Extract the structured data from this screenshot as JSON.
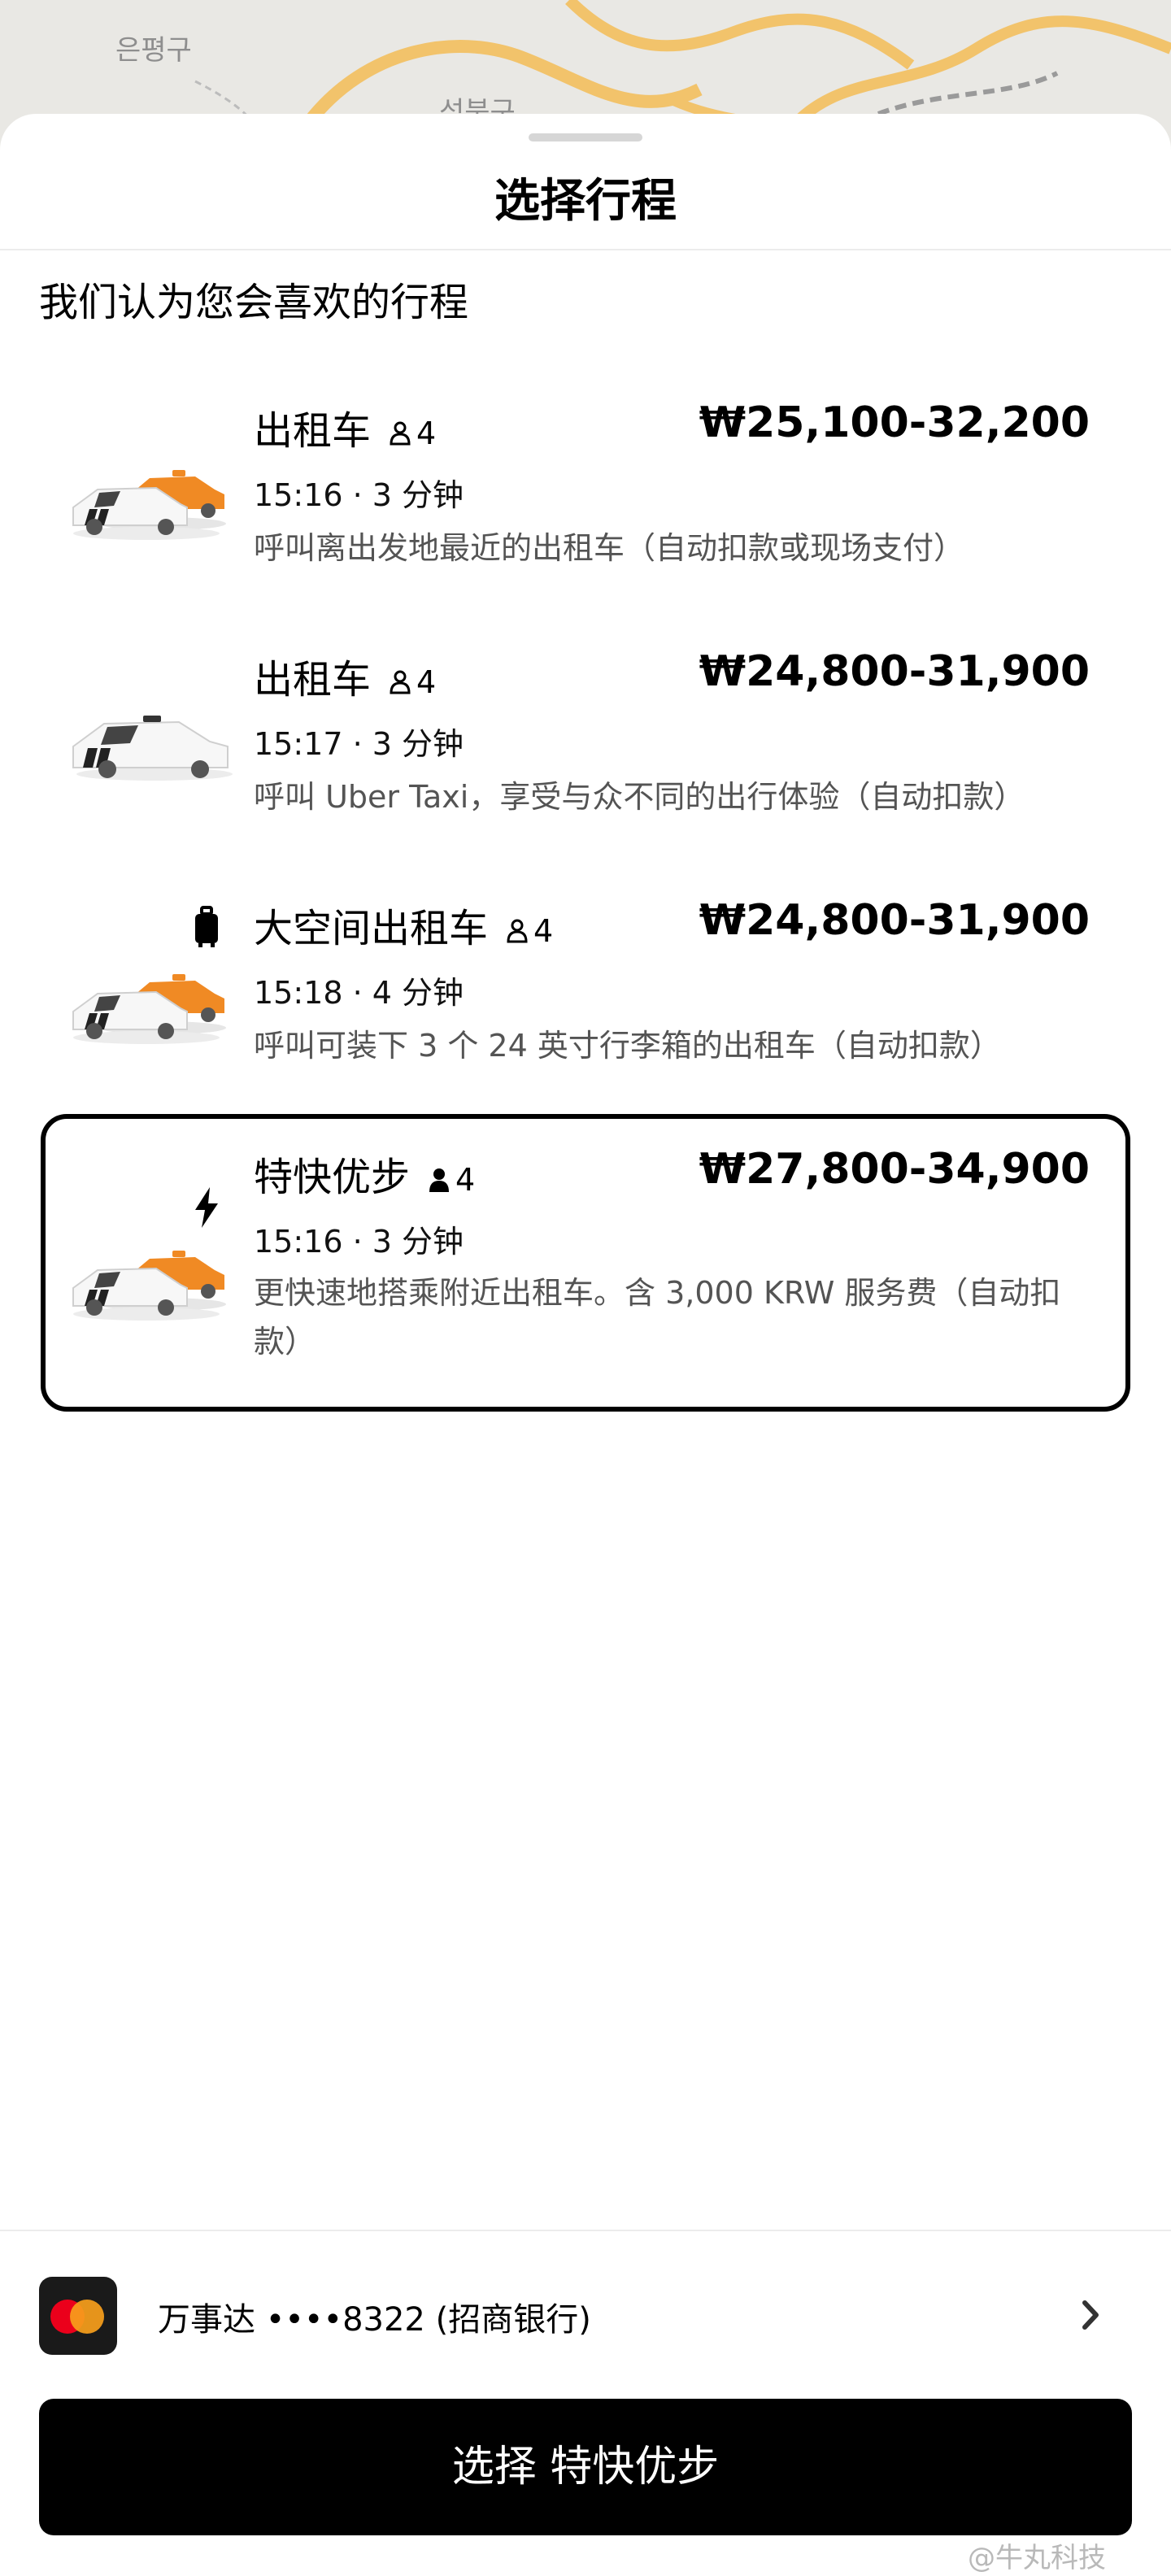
{
  "map": {
    "labels": [
      "은평구",
      "성북구"
    ]
  },
  "sheet": {
    "title": "选择行程",
    "section_heading": "我们认为您会喜欢的行程"
  },
  "rides": [
    {
      "name": "出租车",
      "capacity": "4",
      "price": "₩25,100-32,200",
      "eta": "15:16 · 3 分钟",
      "description": "呼叫离出发地最近的出租车（自动扣款或现场支付）",
      "car_icon": "taxi-pair-icon",
      "selected": false
    },
    {
      "name": "出租车",
      "capacity": "4",
      "price": "₩24,800-31,900",
      "eta": "15:17 · 3 分钟",
      "description": "呼叫 Uber Taxi，享受与众不同的出行体验（自动扣款）",
      "car_icon": "taxi-single-icon",
      "selected": false
    },
    {
      "name": "大空间出租车",
      "capacity": "4",
      "price": "₩24,800-31,900",
      "eta": "15:18 · 4 分钟",
      "description": "呼叫可装下 3 个 24 英寸行李箱的出租车（自动扣款）",
      "car_icon": "taxi-pair-icon",
      "badge_icon": "luggage-icon",
      "selected": false
    },
    {
      "name": "特快优步",
      "capacity": "4",
      "price": "₩27,800-34,900",
      "eta": "15:16 · 3 分钟",
      "description": "更快速地搭乘附近出租车。含 3,000 KRW 服务费（自动扣款）",
      "car_icon": "taxi-pair-icon",
      "badge_icon": "lightning-icon",
      "selected": true
    }
  ],
  "payment": {
    "label": "万事达 ••••8322 (招商银行)",
    "icon": "mastercard-icon"
  },
  "cta": {
    "label": "选择 特快优步"
  },
  "watermark": "@牛丸科技",
  "colors": {
    "accent": "#000000",
    "taxi_orange": "#f08a24",
    "mastercard_red": "#eb001b",
    "mastercard_orange": "#f79e1b"
  }
}
